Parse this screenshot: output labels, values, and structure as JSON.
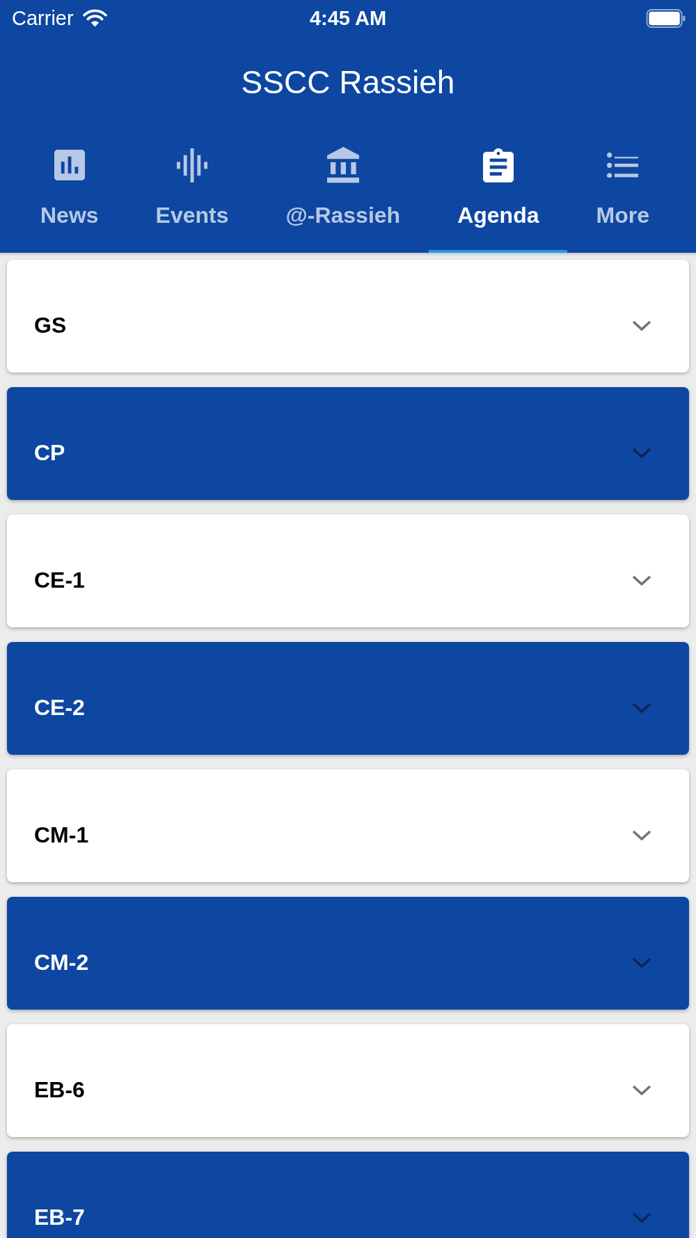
{
  "status_bar": {
    "carrier": "Carrier",
    "time": "4:45 AM"
  },
  "app_bar": {
    "title": "SSCC Rassieh"
  },
  "tabs": [
    {
      "label": "News",
      "selected": false
    },
    {
      "label": "Events",
      "selected": false
    },
    {
      "label": "@-Rassieh",
      "selected": false
    },
    {
      "label": "Agenda",
      "selected": true
    },
    {
      "label": "More",
      "selected": false
    }
  ],
  "cards": [
    {
      "label": "GS",
      "color": "#ffffff",
      "expanded": false
    },
    {
      "label": "CP",
      "color": "#0d47a1",
      "expanded": false
    },
    {
      "label": "CE-1",
      "color": "#ffffff",
      "expanded": false
    },
    {
      "label": "CE-2",
      "color": "#0d47a1",
      "expanded": false
    },
    {
      "label": "CM-1",
      "color": "#ffffff",
      "expanded": false
    },
    {
      "label": "CM-2",
      "color": "#0d47a1",
      "expanded": false
    },
    {
      "label": "EB-6",
      "color": "#ffffff",
      "expanded": false
    },
    {
      "label": "EB-7",
      "color": "#0d47a1",
      "expanded": false
    }
  ]
}
